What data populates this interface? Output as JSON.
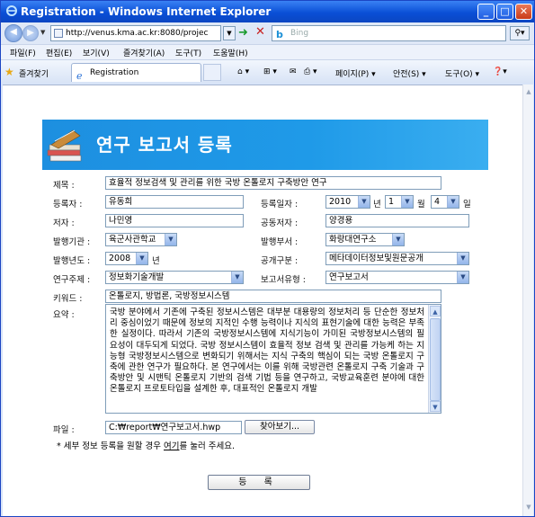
{
  "window": {
    "title": "Registration - Windows Internet Explorer",
    "minimize": "_",
    "maximize": "□",
    "close": "✕"
  },
  "address_bar": {
    "url": "http://venus.kma.ac.kr:8080/projec",
    "search_placeholder": "Bing"
  },
  "menu": {
    "items": [
      "파일(F)",
      "편집(E)",
      "보기(V)",
      "즐겨찾기(A)",
      "도구(T)",
      "도움말(H)"
    ]
  },
  "favorites_bar": {
    "favorites_label": "즐겨찾기",
    "tab_title": "Registration",
    "commands": [
      "페이지(P) ▾",
      "안전(S) ▾",
      "도구(O) ▾"
    ]
  },
  "page": {
    "title": "연구 보고서 등록"
  },
  "form": {
    "title_label": "제목 :",
    "title_value": "효율적 정보검색 및 관리를 위한 국방 온톨로지 구축방안 연구",
    "registrant_label": "등록자 :",
    "registrant_value": "유동희",
    "reg_date_label": "등록일자 :",
    "reg_year": "2010",
    "reg_year_unit": "년",
    "reg_month": "1",
    "reg_month_unit": "월",
    "reg_day": "4",
    "reg_day_unit": "일",
    "author_label": "저자 :",
    "author_value": "나민영",
    "coauthor_label": "공동저자 :",
    "coauthor_value": "양경용",
    "publisher_label": "발행기관 :",
    "publisher_value": "육군사관학교",
    "dept_label": "발행부서 :",
    "dept_value": "화랑대연구소",
    "pub_year_label": "발행년도 :",
    "pub_year_value": "2008",
    "pub_year_unit": "년",
    "disclosure_label": "공개구분 :",
    "disclosure_value": "메타데이터정보및원문공개",
    "topic_label": "연구주제 :",
    "topic_value": "정보화기술개발",
    "report_type_label": "보고서유형 :",
    "report_type_value": "연구보고서",
    "keyword_label": "키워드 :",
    "keyword_value": "온톨로지, 방법론, 국방정보시스템",
    "summary_label": "요약 :",
    "summary_value": "국방 분야에서 기존에 구축된 정보시스템은 대부분 대용량의 정보처리 등 단순한 정보처리 중심이었기 때문에 정보의 지적인 수행 능력이나 지식의 표현기술에 대한 능력은 부족한 실정이다. 따라서 기존의 국방정보시스템에 지식기능이 가미된 국방정보시스템의 필요성이 대두되게 되었다. 국방 정보시스템이 효율적 정보 검색 및 관리를 가능케 하는 지능형 국방정보시스템으로 변화되기 위해서는 지식 구축의 핵심이 되는 국방 온톨로지 구축에 관한 연구가 필요하다. 본 연구에서는 이를 위해 국방관련 온톨로지 구축 기술과 구축방안 및 시맨틱 온톨로지 기반의 검색 기법 등을 연구하고, 국방교육훈련 분야에 대한 온톨로지 프로토타입을 설계한 후, 대표적인 온톨로지 개발",
    "file_label": "파일 :",
    "file_value": "C:₩report₩연구보고서.hwp",
    "browse_button": "찾아보기...",
    "note_prefix": "* 세부 정보 등록을 원할 경우 ",
    "note_link": "여기",
    "note_suffix": "를 눌러 주세요.",
    "submit_button": "등 록"
  }
}
